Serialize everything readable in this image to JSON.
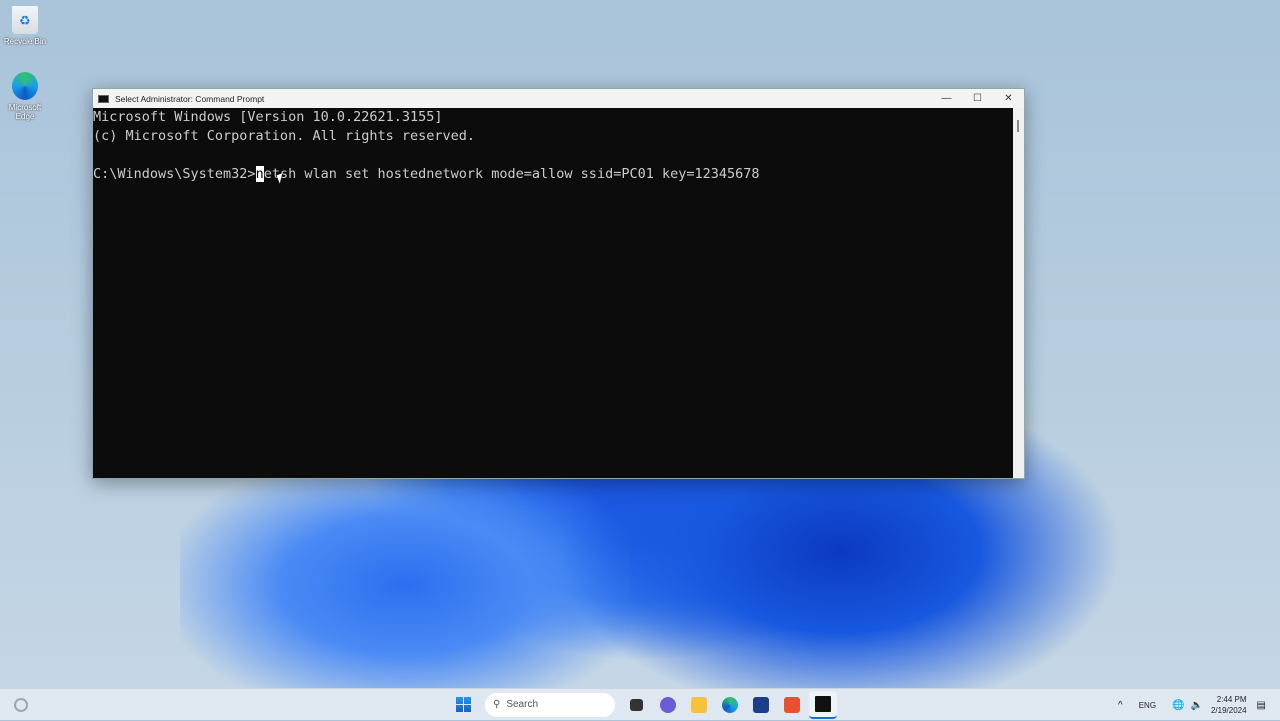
{
  "desktop": {
    "icons": [
      {
        "label": "Recycle Bin",
        "icon": "recycle-bin-icon"
      },
      {
        "label": "Microsoft Edge",
        "icon": "edge-icon"
      }
    ]
  },
  "window": {
    "title": "Select Administrator: Command Prompt",
    "lines": [
      "Microsoft Windows [Version 10.0.22621.3155]",
      "(c) Microsoft Corporation. All rights reserved.",
      ""
    ],
    "prompt": "C:\\Windows\\System32>",
    "cursor_char": "n",
    "command_rest": "etsh wlan set hostednetwork mode=allow ssid=PC01 key=12345678"
  },
  "taskbar": {
    "search_placeholder": "Search",
    "language": "ENG",
    "time": "2:44 PM",
    "date": "2/19/2024"
  }
}
